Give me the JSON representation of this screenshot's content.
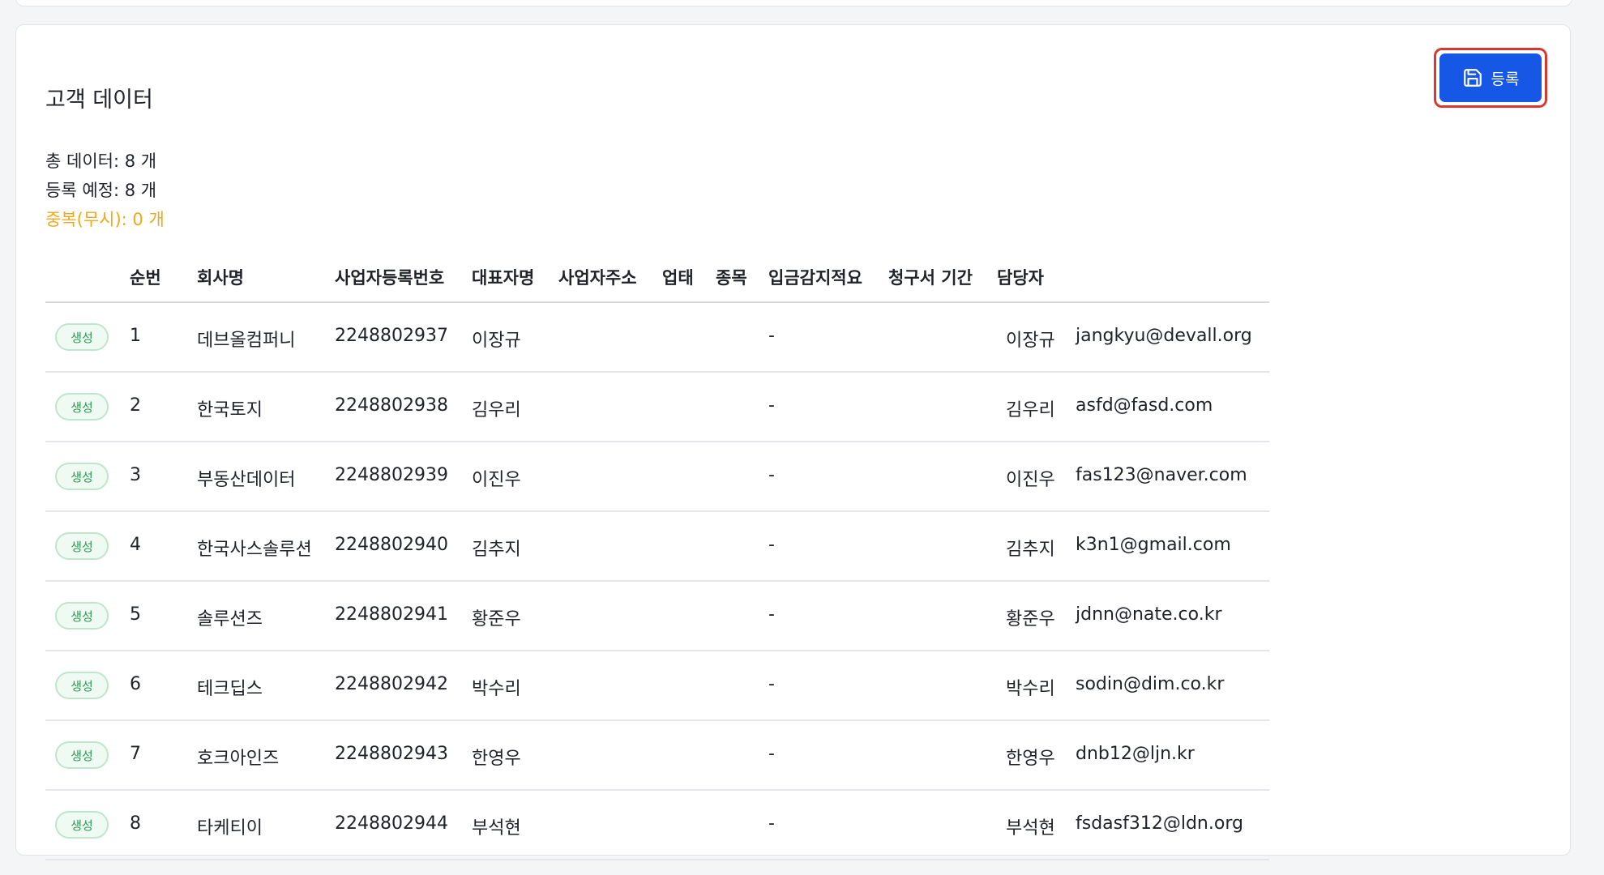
{
  "section": {
    "title": "고객 데이터",
    "register_label": "등록"
  },
  "stats": {
    "total": "총 데이터: 8 개",
    "pending": "등록 예정: 8 개",
    "duplicate": "중복(무시): 0 개"
  },
  "colors": {
    "primary": "#1757e6",
    "highlight_border": "#d9382e",
    "duplicate_text": "#f0a81a",
    "badge_green": "#2c9a55"
  },
  "table": {
    "headers": {
      "seq": "순번",
      "company": "회사명",
      "biz_no": "사업자등록번호",
      "rep": "대표자명",
      "address": "사업자주소",
      "biz_type": "업태",
      "item": "종목",
      "memo": "입금감지적요",
      "period": "청구서 기간",
      "manager": "담당자"
    },
    "rows": [
      {
        "badge": "생성",
        "seq": "1",
        "company": "데브올컴퍼니",
        "biz_no": "2248802937",
        "rep": "이장규",
        "memo": "-",
        "manager": "이장규",
        "email": "jangkyu@devall.org"
      },
      {
        "badge": "생성",
        "seq": "2",
        "company": "한국토지",
        "biz_no": "2248802938",
        "rep": "김우리",
        "memo": "-",
        "manager": "김우리",
        "email": "asfd@fasd.com"
      },
      {
        "badge": "생성",
        "seq": "3",
        "company": "부동산데이터",
        "biz_no": "2248802939",
        "rep": "이진우",
        "memo": "-",
        "manager": "이진우",
        "email": "fas123@naver.com"
      },
      {
        "badge": "생성",
        "seq": "4",
        "company": "한국사스솔루션",
        "biz_no": "2248802940",
        "rep": "김추지",
        "memo": "-",
        "manager": "김추지",
        "email": "k3n1@gmail.com"
      },
      {
        "badge": "생성",
        "seq": "5",
        "company": "솔루션즈",
        "biz_no": "2248802941",
        "rep": "황준우",
        "memo": "-",
        "manager": "황준우",
        "email": "jdnn@nate.co.kr"
      },
      {
        "badge": "생성",
        "seq": "6",
        "company": "테크딥스",
        "biz_no": "2248802942",
        "rep": "박수리",
        "memo": "-",
        "manager": "박수리",
        "email": "sodin@dim.co.kr"
      },
      {
        "badge": "생성",
        "seq": "7",
        "company": "호크아인즈",
        "biz_no": "2248802943",
        "rep": "한영우",
        "memo": "-",
        "manager": "한영우",
        "email": "dnb12@ljn.kr"
      },
      {
        "badge": "생성",
        "seq": "8",
        "company": "타케티이",
        "biz_no": "2248802944",
        "rep": "부석현",
        "memo": "-",
        "manager": "부석현",
        "email": "fsdasf312@ldn.org"
      }
    ]
  }
}
